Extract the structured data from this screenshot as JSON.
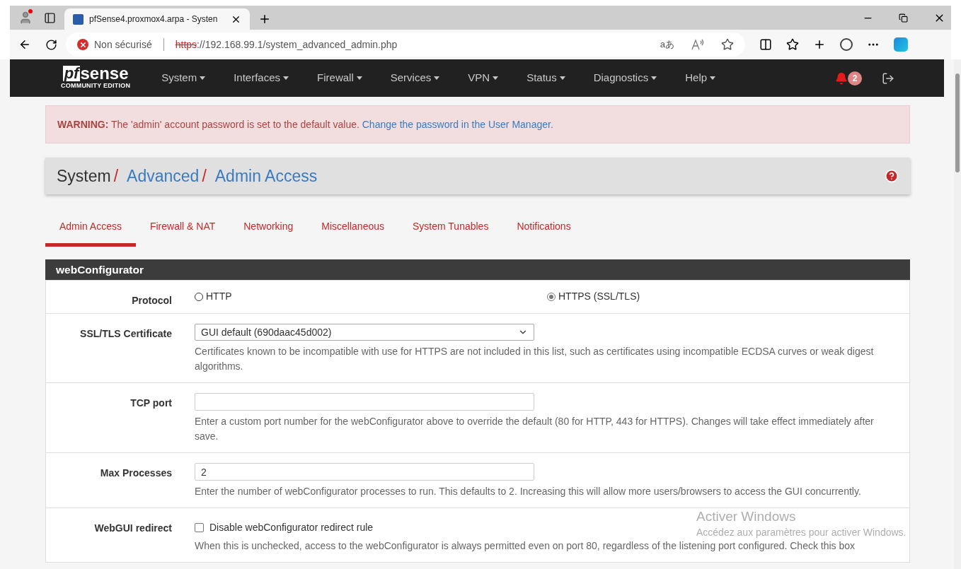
{
  "browser": {
    "tab_title": "pfSense4.proxmox4.arpa - Systen",
    "security": "Non sécurisé",
    "url_scheme": "https",
    "url_rest": "://192.168.99.1/system_advanced_admin.php",
    "translate_label": "aあ"
  },
  "navbar": {
    "logo": "sense",
    "logo_pf": "pf",
    "edition": "COMMUNITY EDITION",
    "menus": [
      "System",
      "Interfaces",
      "Firewall",
      "Services",
      "VPN",
      "Status",
      "Diagnostics",
      "Help"
    ],
    "alert_count": "2"
  },
  "warning": {
    "label": "WARNING:",
    "text": "The 'admin' account password is set to the default value.",
    "link": "Change the password in the User Manager."
  },
  "breadcrumb": [
    {
      "label": "System",
      "link": false,
      "separator": "/"
    },
    {
      "label": "Advanced",
      "link": true,
      "separator": "/"
    },
    {
      "label": "Admin Access",
      "link": true
    }
  ],
  "tabs": [
    {
      "label": "Admin Access",
      "selected": true
    },
    {
      "label": "Firewall & NAT",
      "selected": false
    },
    {
      "label": "Networking",
      "selected": false
    },
    {
      "label": "Miscellaneous",
      "selected": false
    },
    {
      "label": "System Tunables",
      "selected": false
    },
    {
      "label": "Notifications",
      "selected": false
    }
  ],
  "panel": {
    "title": "webConfigurator",
    "rows": [
      {
        "kind": "radio",
        "label": "Protocol",
        "options": [
          {
            "label": "HTTP",
            "selected": false
          },
          {
            "label": "HTTPS (SSL/TLS)",
            "selected": true
          }
        ]
      },
      {
        "kind": "select",
        "label": "SSL/TLS Certificate",
        "value": "GUI default (690daac45d002)",
        "help": "Certificates known to be incompatible with use for HTTPS are not included in this list, such as certificates using incompatible ECDSA curves or weak digest algorithms."
      },
      {
        "kind": "input",
        "label": "TCP port",
        "value": "",
        "help": "Enter a custom port number for the webConfigurator above to override the default (80 for HTTP, 443 for HTTPS). Changes will take effect immediately after save."
      },
      {
        "kind": "input",
        "label": "Max Processes",
        "value": "2",
        "help": "Enter the number of webConfigurator processes to run. This defaults to 2. Increasing this will allow more users/browsers to access the GUI concurrently."
      },
      {
        "kind": "checkbox",
        "label": "WebGUI redirect",
        "option": "Disable webConfigurator redirect rule",
        "checked": false,
        "help": "When this is unchecked, access to the webConfigurator is always permitted even on port 80, regardless of the listening port configured. Check this box"
      }
    ]
  },
  "os_notice": {
    "title": "Activer Windows",
    "text": "Accédez aux paramètres pour activer Windows."
  }
}
